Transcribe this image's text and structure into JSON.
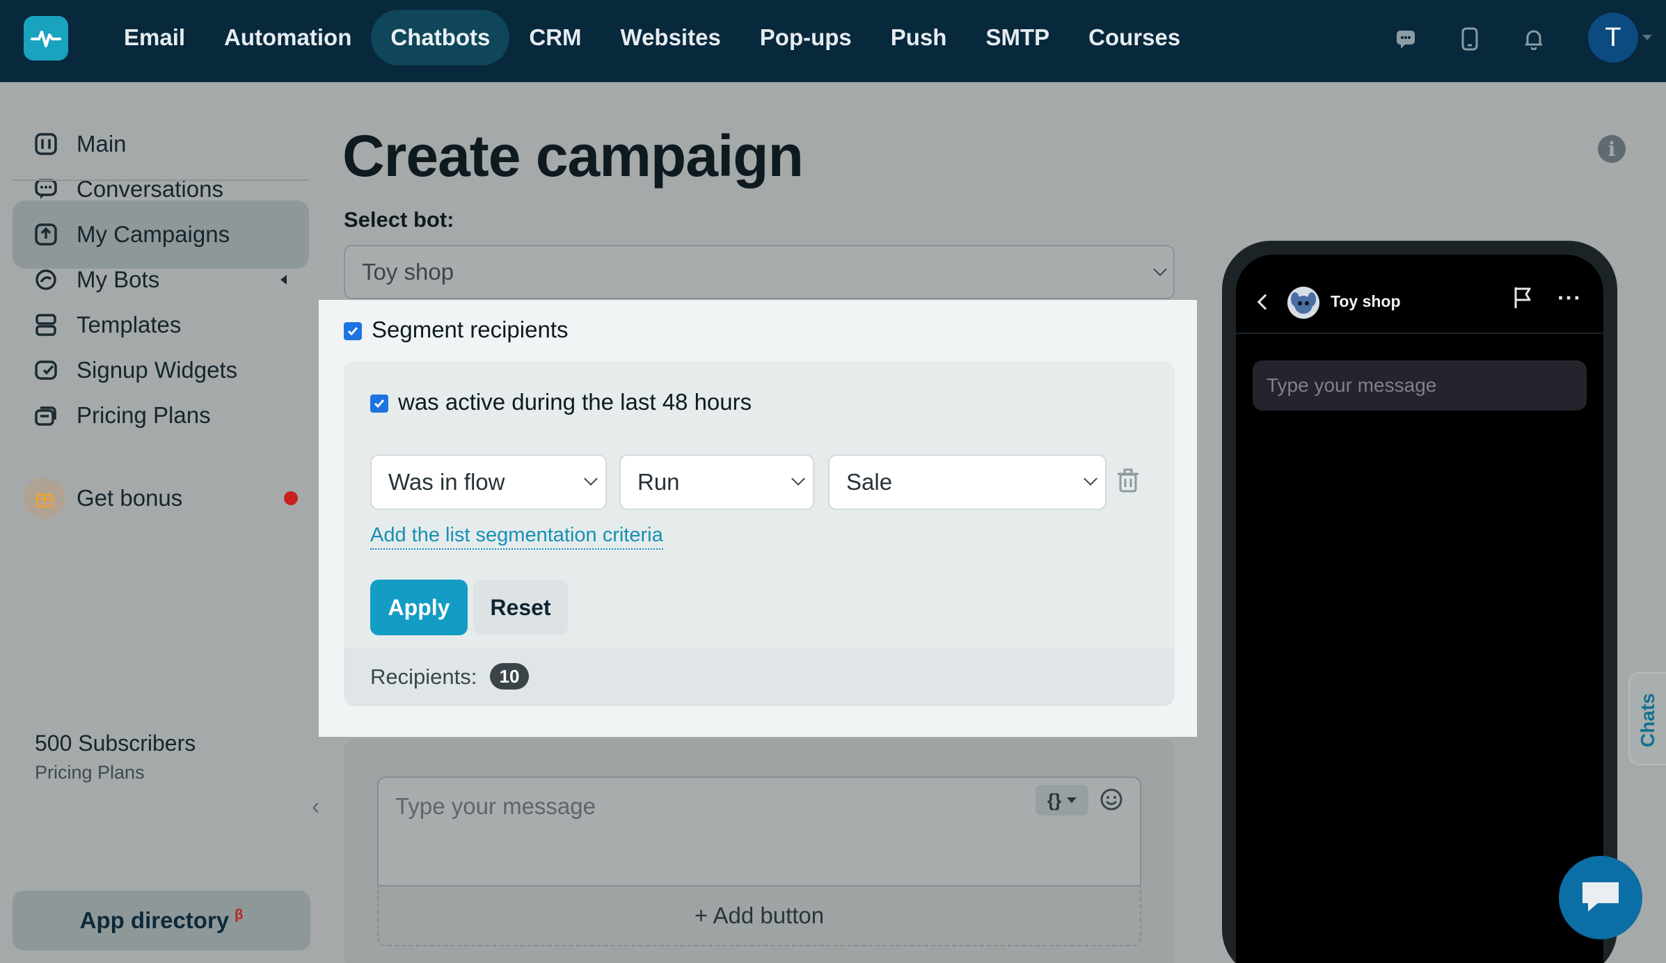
{
  "topbar": {
    "nav": [
      "Email",
      "Automation",
      "Chatbots",
      "CRM",
      "Websites",
      "Pop-ups",
      "Push",
      "SMTP",
      "Courses"
    ],
    "active_nav": "Chatbots",
    "avatar_initial": "T"
  },
  "sidebar": {
    "items": [
      {
        "label": "Main",
        "icon": "main-icon"
      },
      {
        "label": "Conversations",
        "icon": "conversations-icon"
      },
      {
        "label": "My Campaigns",
        "icon": "campaigns-icon",
        "active": true
      },
      {
        "label": "My Bots",
        "icon": "bots-icon"
      },
      {
        "label": "Templates",
        "icon": "templates-icon"
      },
      {
        "label": "Signup Widgets",
        "icon": "widgets-icon"
      },
      {
        "label": "Pricing Plans",
        "icon": "pricing-icon"
      }
    ],
    "bonus_label": "Get bonus",
    "subscribers": "500 Subscribers",
    "plan_link": "Pricing Plans",
    "app_directory": "App directory",
    "beta": "β"
  },
  "main": {
    "title": "Create campaign",
    "select_bot_label": "Select bot:",
    "selected_bot": "Toy shop",
    "segment_label": "Segment recipients",
    "segment_checked": true,
    "active_label": "was active during the last 48 hours",
    "active_checked": true,
    "criteria": [
      "Was in flow",
      "Run",
      "Sale"
    ],
    "add_criteria_link": "Add the list segmentation criteria",
    "apply_label": "Apply",
    "reset_label": "Reset",
    "recipients_label": "Recipients:",
    "recipients_count": "10",
    "message_placeholder": "Type your message",
    "variables_label": "{}",
    "add_button_label": "+ Add button"
  },
  "phone": {
    "bot_name": "Toy shop",
    "more_label": "···",
    "input_placeholder": "Type your message"
  },
  "chats_tab": "Chats",
  "colors": {
    "topbar": "#08283c",
    "accent": "#149dc4",
    "checkbox": "#1d74e0",
    "badge": "#3a4347"
  }
}
